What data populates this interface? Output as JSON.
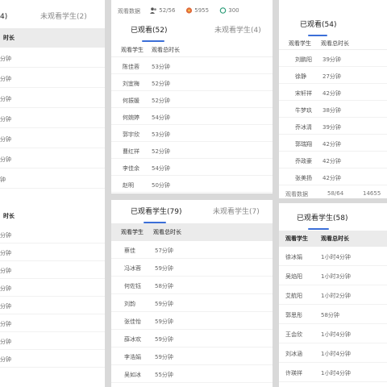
{
  "panelA": {
    "tab_active": "4)",
    "tab_inactive": "未观看学生(2)",
    "header": "时长",
    "rows": [
      "分钟",
      "分钟",
      "分钟",
      "分钟",
      "分钟",
      "分钟",
      "钟"
    ],
    "row_bottom": "时长",
    "lower_rows": [
      "分钟",
      "分钟",
      "分钟",
      "分钟",
      "分钟",
      "分钟",
      "分钟",
      "分钟"
    ]
  },
  "panelB": {
    "stats_label": "观看数据",
    "stat1": "52/56",
    "stat2": "5955",
    "stat3": "300",
    "tab_active": "已观看(52)",
    "tab_inactive": "未观看学生(4)",
    "col_name": "观看学生",
    "col_dur": "观看总时长",
    "rows": [
      {
        "name": "陈佳蓉",
        "dur": "53分钟"
      },
      {
        "name": "刘宜梅",
        "dur": "52分钟"
      },
      {
        "name": "何振媛",
        "dur": "52分钟"
      },
      {
        "name": "何婉婷",
        "dur": "54分钟"
      },
      {
        "name": "郭宇欣",
        "dur": "53分钟"
      },
      {
        "name": "曹红祥",
        "dur": "52分钟"
      },
      {
        "name": "李佳余",
        "dur": "54分钟"
      },
      {
        "name": "赵明",
        "dur": "50分钟"
      }
    ]
  },
  "panelC": {
    "tab_active": "已观看(54)",
    "col_name": "观看学生",
    "col_dur": "观看总时长",
    "rows": [
      {
        "name": "刘鹏阳",
        "dur": "39分钟"
      },
      {
        "name": "徐静",
        "dur": "27分钟"
      },
      {
        "name": "宋轩祥",
        "dur": "42分钟"
      },
      {
        "name": "牛梦玖",
        "dur": "38分钟"
      },
      {
        "name": "乔冰清",
        "dur": "39分钟"
      },
      {
        "name": "郭瑞翔",
        "dur": "42分钟"
      },
      {
        "name": "乔政豪",
        "dur": "42分钟"
      },
      {
        "name": "张美扬",
        "dur": "42分钟"
      }
    ],
    "stats_label": "观看数据",
    "stat1": "58/64",
    "stat2": "14655"
  },
  "panelD": {
    "tab_active": "已观看学生(79)",
    "tab_inactive": "未观看学生(7)",
    "col_name": "观看学生",
    "col_dur": "观看总时长",
    "rows": [
      {
        "name": "蔡佳",
        "dur": "57分钟"
      },
      {
        "name": "冯冰蓉",
        "dur": "59分钟"
      },
      {
        "name": "何佐钰",
        "dur": "58分钟"
      },
      {
        "name": "刘韵",
        "dur": "59分钟"
      },
      {
        "name": "张佳怡",
        "dur": "59分钟"
      },
      {
        "name": "薛冰欢",
        "dur": "59分钟"
      },
      {
        "name": "李浩娟",
        "dur": "59分钟"
      },
      {
        "name": "吴如冰",
        "dur": "55分钟"
      }
    ]
  },
  "panelE": {
    "tab_active": "已观看学生(58)",
    "col_name": "观看学生",
    "col_dur": "观看总时长",
    "rows": [
      {
        "name": "徐冰娟",
        "dur": "1小时4分钟"
      },
      {
        "name": "吴焰阳",
        "dur": "1小时3分钟"
      },
      {
        "name": "艾航阳",
        "dur": "1小时2分钟"
      },
      {
        "name": "郭思彤",
        "dur": "58分钟"
      },
      {
        "name": "王会欣",
        "dur": "1小时4分钟"
      },
      {
        "name": "刘冰涵",
        "dur": "1小时4分钟"
      },
      {
        "name": "许瑛祥",
        "dur": "1小时4分钟"
      }
    ]
  }
}
